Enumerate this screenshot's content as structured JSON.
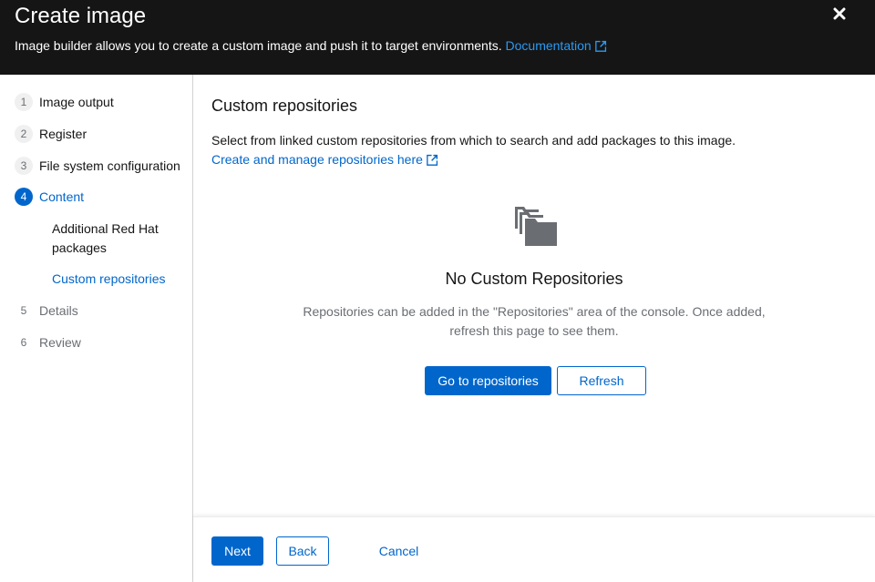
{
  "header": {
    "title": "Create image",
    "description": "Image builder allows you to create a custom image and push it to target environments.",
    "doc_link": "Documentation",
    "close_icon": "close-icon",
    "link_color": "#2b9af3",
    "background": "#151515"
  },
  "nav": {
    "steps": [
      {
        "num": "1",
        "label": "Image output",
        "state": "default"
      },
      {
        "num": "2",
        "label": "Register",
        "state": "default"
      },
      {
        "num": "3",
        "label": "File system configuration",
        "state": "default"
      },
      {
        "num": "4",
        "label": "Content",
        "state": "current"
      },
      {
        "num": "5",
        "label": "Details",
        "state": "disabled"
      },
      {
        "num": "6",
        "label": "Review",
        "state": "disabled"
      }
    ],
    "substeps": [
      {
        "label": "Additional Red Hat packages",
        "state": "default"
      },
      {
        "label": "Custom repositories",
        "state": "current"
      }
    ],
    "accent": "#0066cc"
  },
  "main": {
    "title": "Custom repositories",
    "description": "Select from linked custom repositories from which to search and add packages to this image.",
    "manage_link": "Create and manage repositories here",
    "empty_state": {
      "icon": "repositories-icon",
      "title": "No Custom Repositories",
      "body": "Repositories can be added in the \"Repositories\" area of the console. Once added, refresh this page to see them.",
      "primary_button": "Go to repositories",
      "secondary_button": "Refresh"
    }
  },
  "footer": {
    "next": "Next",
    "back": "Back",
    "cancel": "Cancel"
  }
}
